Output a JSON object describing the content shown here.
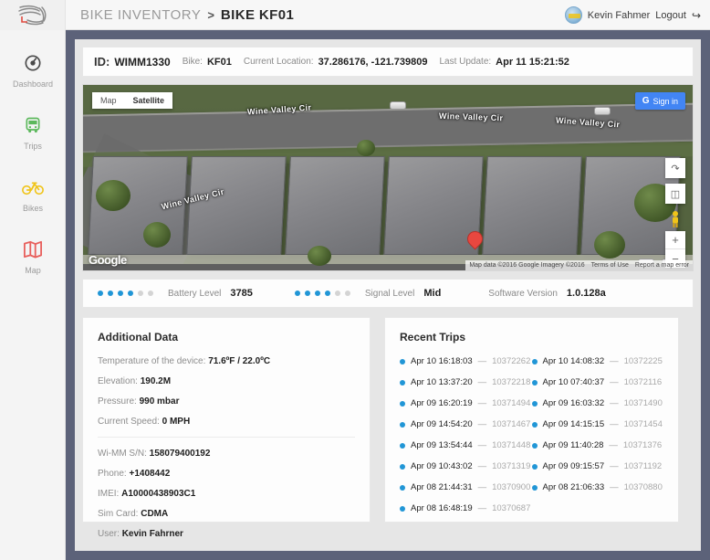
{
  "header": {
    "logo_name": "fan-spiral-logo",
    "breadcrumb_root": "BIKE INVENTORY",
    "breadcrumb_separator": ">",
    "breadcrumb_current": "BIKE KF01",
    "user_name": "Kevin Fahmer",
    "logout_label": "Logout",
    "logout_icon": "sign-out-icon"
  },
  "sidebar": {
    "items": [
      {
        "label": "Dashboard",
        "icon": "compass-icon",
        "color": "#4a4a4a"
      },
      {
        "label": "Trips",
        "icon": "bus-icon",
        "color": "#5cb85c"
      },
      {
        "label": "Bikes",
        "icon": "bicycle-icon",
        "color": "#f0c419"
      },
      {
        "label": "Map",
        "icon": "map-icon",
        "color": "#e8605d"
      }
    ]
  },
  "id_bar": {
    "id_label": "ID:",
    "id_value": "WIMM1330",
    "bike_label": "Bike:",
    "bike_value": "KF01",
    "location_label": "Current Location:",
    "location_value": "37.286176, -121.739809",
    "update_label": "Last Update:",
    "update_value": "Apr 11 15:21:52"
  },
  "map": {
    "type_buttons": [
      {
        "label": "Map",
        "active": false
      },
      {
        "label": "Satellite",
        "active": true
      }
    ],
    "signin_label": "Sign in",
    "signin_icon": "google-g-icon",
    "controls": [
      {
        "name": "compass-icon",
        "glyph": "⤴"
      },
      {
        "name": "fullscreen-icon",
        "glyph": "⬚"
      },
      {
        "name": "pegman-icon",
        "glyph": "🚶"
      }
    ],
    "zoom_in": "+",
    "zoom_out": "−",
    "watermark": "Google",
    "street_labels": [
      "Wine Valley Cir",
      "Wine Valley Cir",
      "Wine Valley Cir",
      "Wine Valley Cir"
    ],
    "marker_name": "location-pin",
    "attribution": [
      "Map data ©2016 Google Imagery ©2016",
      "Terms of Use",
      "Report a map error"
    ]
  },
  "status": {
    "battery_label": "Battery Level",
    "battery_value": "3785",
    "battery_dots_total": 6,
    "battery_dots_filled": 4,
    "signal_label": "Signal Level",
    "signal_value": "Mid",
    "signal_dots_total": 6,
    "signal_dots_filled": 4,
    "version_label": "Software Version",
    "version_value": "1.0.128a",
    "accent_color": "#2196d6"
  },
  "additional_data": {
    "title": "Additional Data",
    "rows_top": [
      {
        "label": "Temperature of the device:",
        "value": "71.6ºF / 22.0ºC"
      },
      {
        "label": "Elevation:",
        "value": "190.2M"
      },
      {
        "label": "Pressure:",
        "value": "990 mbar"
      },
      {
        "label": "Current Speed:",
        "value": "0 MPH"
      }
    ],
    "rows_bottom": [
      {
        "label": "Wi-MM S/N:",
        "value": "158079400192"
      },
      {
        "label": "Phone:",
        "value": "+1408442"
      },
      {
        "label": "IMEI:",
        "value": "A10000438903C1"
      },
      {
        "label": "Sim Card:",
        "value": "CDMA"
      },
      {
        "label": "User:",
        "value": "Kevin Fahrner"
      }
    ]
  },
  "recent_trips": {
    "title": "Recent Trips",
    "dash": "—",
    "items": [
      {
        "time": "Apr 10 16:18:03",
        "id": "10372262"
      },
      {
        "time": "Apr 10 14:08:32",
        "id": "10372225"
      },
      {
        "time": "Apr 10 13:37:20",
        "id": "10372218"
      },
      {
        "time": "Apr 10 07:40:37",
        "id": "10372116"
      },
      {
        "time": "Apr 09 16:20:19",
        "id": "10371494"
      },
      {
        "time": "Apr 09 16:03:32",
        "id": "10371490"
      },
      {
        "time": "Apr 09 14:54:20",
        "id": "10371467"
      },
      {
        "time": "Apr 09 14:15:15",
        "id": "10371454"
      },
      {
        "time": "Apr 09 13:54:44",
        "id": "10371448"
      },
      {
        "time": "Apr 09 11:40:28",
        "id": "10371376"
      },
      {
        "time": "Apr 09 10:43:02",
        "id": "10371319"
      },
      {
        "time": "Apr 09 09:15:57",
        "id": "10371192"
      },
      {
        "time": "Apr 08 21:44:31",
        "id": "10370900"
      },
      {
        "time": "Apr 08 21:06:33",
        "id": "10370880"
      },
      {
        "time": "Apr 08 16:48:19",
        "id": "10370687"
      }
    ]
  }
}
